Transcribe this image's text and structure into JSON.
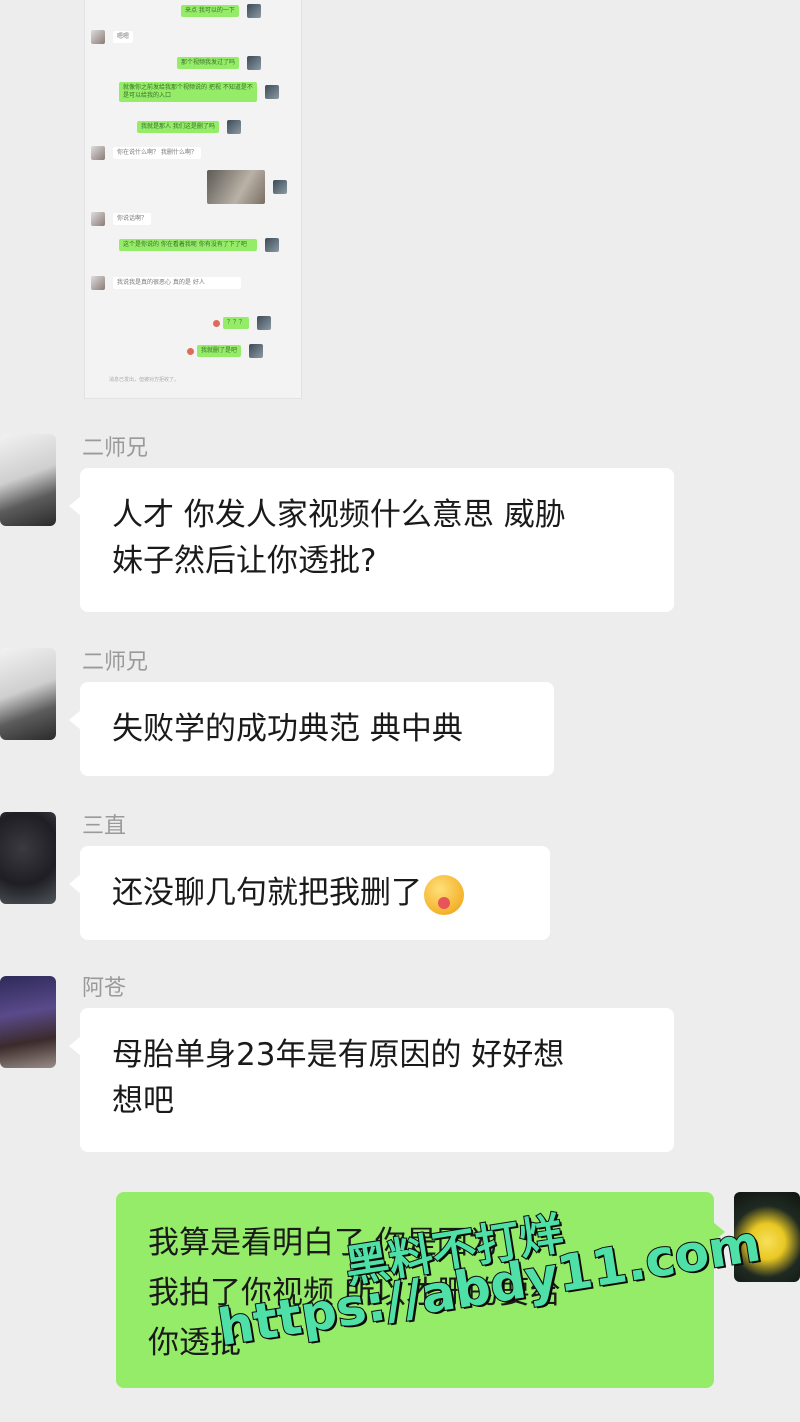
{
  "embedded": {
    "rows": [
      {
        "side": "right",
        "text": "来点 我可以的一下"
      },
      {
        "side": "left",
        "text": "嗯嗯"
      },
      {
        "side": "right",
        "text": "那个视频我发过了吗"
      },
      {
        "side": "right",
        "text": "就像你之前发给我那个视频说的 把视 不知道是不是可以给我的入口"
      },
      {
        "side": "right",
        "text": "我就是那人 我们这是删了吗"
      },
      {
        "side": "left",
        "text": "你在说什么啊？  我删什么啊？"
      },
      {
        "side": "left",
        "text": "你说话啊？"
      },
      {
        "side": "right",
        "text": "这个是你说的 你在看着我呢 你有没有了下了吧"
      },
      {
        "side": "left",
        "text": "我说我是真的很恶心 真的是 好人"
      },
      {
        "side": "right",
        "text": "？？？"
      },
      {
        "side": "right",
        "text": "我就删了是吧"
      }
    ],
    "footer": "消息已发出，但被对方拒收了。"
  },
  "messages": [
    {
      "sender": "二师兄",
      "line1": "人才 你发人家视频什么意思 威胁",
      "line2": "妹子然后让你透批?"
    },
    {
      "sender": "二师兄",
      "line1": "失败学的成功典范 典中典"
    },
    {
      "sender": "三直",
      "line1": "还没聊几句就把我删了"
    },
    {
      "sender": "阿苍",
      "line1": "母胎单身23年是有原因的 好好想",
      "line2": "想吧"
    }
  ],
  "self_message": {
    "line1": "我算是看明白了 你是因为",
    "line2": "我拍了你视频 所以才删的要给",
    "line3": "你透批"
  },
  "watermark": {
    "line1": "黑料不打烊",
    "line2": "https://abdy11.com"
  }
}
